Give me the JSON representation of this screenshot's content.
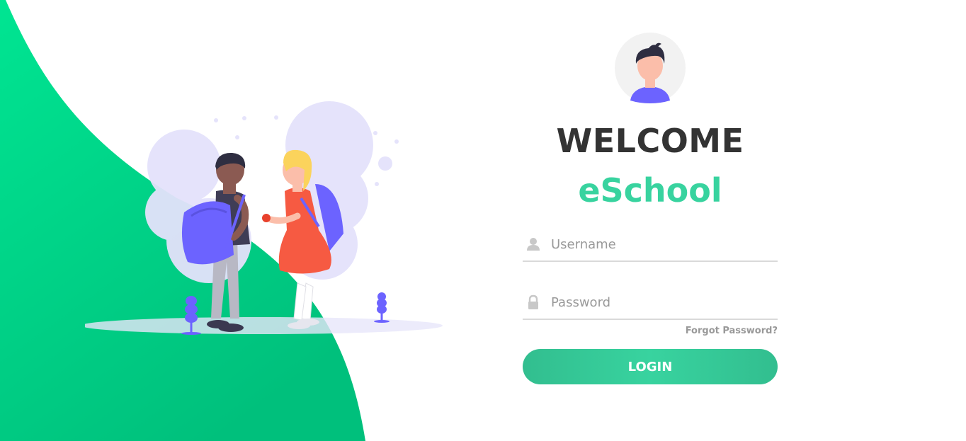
{
  "welcome": "WELCOME",
  "brand": "eSchool",
  "username": {
    "placeholder": "Username",
    "value": "",
    "icon": "user-icon"
  },
  "password": {
    "placeholder": "Password",
    "value": "",
    "icon": "lock-icon"
  },
  "forgot_label": "Forgot Password?",
  "login_label": "LOGIN",
  "colors": {
    "accent": "#38d39f",
    "accent_dark": "#32be8f",
    "wave_start": "#00e08f",
    "wave_end": "#00c480",
    "text_dark": "#333333",
    "muted": "#999999",
    "shape_purple": "#6c63ff"
  }
}
